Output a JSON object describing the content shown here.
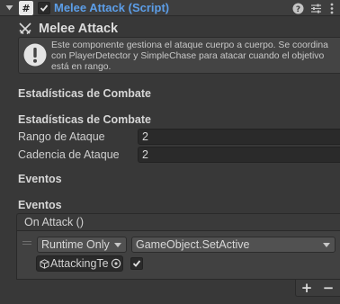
{
  "component": {
    "title": "Melee Attack (Script)",
    "enabled": true,
    "script_glyph": "#",
    "header_icons": [
      "help-icon",
      "presets-icon",
      "more-menu-icon"
    ]
  },
  "inspector": {
    "title": "Melee Attack",
    "help_text": "Este componente gestiona el ataque cuerpo a cuerpo. Se coordina con PlayerDetector y SimpleChase para atacar cuando el objetivo está en rango."
  },
  "stats": {
    "header_title": "Estadísticas de Combate",
    "section_title": "Estadísticas de Combate",
    "attack_range_label": "Rango de Ataque",
    "attack_range_value": "2",
    "attack_rate_label": "Cadencia de Ataque",
    "attack_rate_value": "2"
  },
  "events": {
    "header_title": "Eventos",
    "section_title": "Eventos",
    "event_name": "On Attack ()",
    "listener": {
      "runtime_mode": "Runtime Only",
      "function": "GameObject.SetActive",
      "target_object": "AttackingTe",
      "argument_checked": true
    },
    "add_label": "+",
    "remove_label": "−"
  },
  "colors": {
    "title_blue": "#5c9ee8",
    "background": "#383838",
    "field_bg": "#2a2a2a"
  }
}
